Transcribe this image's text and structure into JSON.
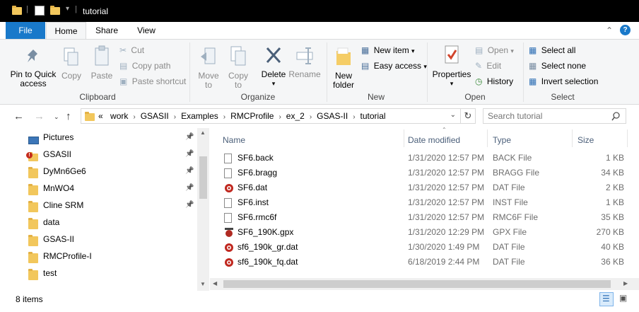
{
  "titlebar": {
    "title": "tutorial"
  },
  "ribbon_tabs": [
    "File",
    "Home",
    "Share",
    "View"
  ],
  "ribbon": {
    "clipboard": {
      "label": "Clipboard",
      "pin_line1": "Pin to Quick",
      "pin_line2": "access",
      "copy": "Copy",
      "paste": "Paste",
      "cut": "Cut",
      "copy_path": "Copy path",
      "paste_shortcut": "Paste shortcut"
    },
    "organize": {
      "label": "Organize",
      "move_to": "Move",
      "move_to_sub": "to",
      "copy_to": "Copy",
      "copy_to_sub": "to",
      "delete": "Delete",
      "rename": "Rename"
    },
    "new": {
      "label": "New",
      "new_folder_line1": "New",
      "new_folder_line2": "folder",
      "new_item": "New item",
      "easy_access": "Easy access"
    },
    "open": {
      "label": "Open",
      "properties": "Properties",
      "open": "Open",
      "edit": "Edit",
      "history": "History"
    },
    "select": {
      "label": "Select",
      "select_all": "Select all",
      "select_none": "Select none",
      "invert_selection": "Invert selection"
    }
  },
  "address": {
    "prefix": "«",
    "crumbs": [
      "work",
      "GSASII",
      "Examples",
      "RMCProfile",
      "ex_2",
      "GSAS-II",
      "tutorial"
    ]
  },
  "search": {
    "placeholder": "Search tutorial"
  },
  "nav_pane": {
    "items": [
      {
        "label": "Pictures",
        "icon": "pictures-icon",
        "pinned": true
      },
      {
        "label": "GSASII",
        "icon": "gsasii-folder-icon",
        "pinned": true
      },
      {
        "label": "DyMn6Ge6",
        "icon": "folder-icon",
        "pinned": true
      },
      {
        "label": "MnWO4",
        "icon": "folder-icon",
        "pinned": true
      },
      {
        "label": "Cline SRM",
        "icon": "folder-icon",
        "pinned": true
      },
      {
        "label": "data",
        "icon": "folder-icon",
        "pinned": false
      },
      {
        "label": "GSAS-II",
        "icon": "folder-icon",
        "pinned": false
      },
      {
        "label": "RMCProfile-I",
        "icon": "folder-icon",
        "pinned": false
      },
      {
        "label": "test",
        "icon": "folder-icon",
        "pinned": false
      }
    ]
  },
  "file_list": {
    "columns": {
      "name": "Name",
      "date": "Date modified",
      "type": "Type",
      "size": "Size"
    },
    "rows": [
      {
        "name": "SF6.back",
        "date": "1/31/2020 12:57 PM",
        "type": "BACK File",
        "size": "1 KB",
        "icon": "generic-file-icon"
      },
      {
        "name": "SF6.bragg",
        "date": "1/31/2020 12:57 PM",
        "type": "BRAGG File",
        "size": "34 KB",
        "icon": "generic-file-icon"
      },
      {
        "name": "SF6.dat",
        "date": "1/31/2020 12:57 PM",
        "type": "DAT File",
        "size": "2 KB",
        "icon": "dat-file-icon"
      },
      {
        "name": "SF6.inst",
        "date": "1/31/2020 12:57 PM",
        "type": "INST File",
        "size": "1 KB",
        "icon": "generic-file-icon"
      },
      {
        "name": "SF6.rmc6f",
        "date": "1/31/2020 12:57 PM",
        "type": "RMC6F File",
        "size": "35 KB",
        "icon": "generic-file-icon"
      },
      {
        "name": "SF6_190K.gpx",
        "date": "1/31/2020 12:29 PM",
        "type": "GPX File",
        "size": "270 KB",
        "icon": "gpx-file-icon"
      },
      {
        "name": "sf6_190k_gr.dat",
        "date": "1/30/2020 1:49 PM",
        "type": "DAT File",
        "size": "40 KB",
        "icon": "dat-file-icon"
      },
      {
        "name": "sf6_190k_fq.dat",
        "date": "6/18/2019 2:44 PM",
        "type": "DAT File",
        "size": "36 KB",
        "icon": "dat-file-icon"
      }
    ]
  },
  "status": {
    "item_count": "8 items"
  },
  "colors": {
    "file_tab": "#1979ca",
    "folder": "#f2c75c",
    "accent_blue": "#1979ca"
  }
}
